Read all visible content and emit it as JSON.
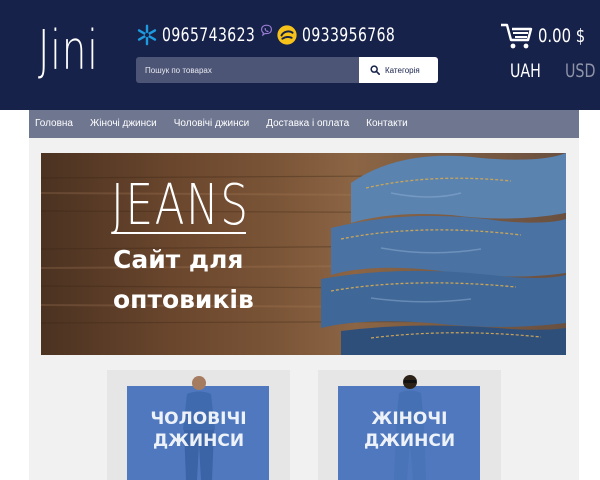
{
  "header": {
    "logo": "Jini",
    "phone1": "0965743623",
    "phone2": "0933956768",
    "search_placeholder": "Пошук по товарах",
    "category_button": "Категорія",
    "cart_total": "0.00 $",
    "currencies": [
      "UAH",
      "USD"
    ]
  },
  "nav": {
    "items": [
      "Головна",
      "Жіночі джинси",
      "Чоловічі джинси",
      "Доставка і оплата",
      "Контакти"
    ]
  },
  "banner": {
    "title": "JEANS",
    "subtitle_line1": "Сайт для",
    "subtitle_line2": "оптовиків"
  },
  "categories": [
    {
      "line1": "ЧОЛОВІЧІ",
      "line2": "ДЖИНСИ"
    },
    {
      "line1": "ЖІНОЧІ",
      "line2": "ДЖИНСИ"
    }
  ],
  "colors": {
    "header_bg": "#17224a",
    "nav_bg": "#6f7690",
    "category_box": "#4f78bf",
    "kyivstar": "#1e9be0",
    "lifecell": "#f7c21a",
    "viber": "#7d62b8"
  }
}
